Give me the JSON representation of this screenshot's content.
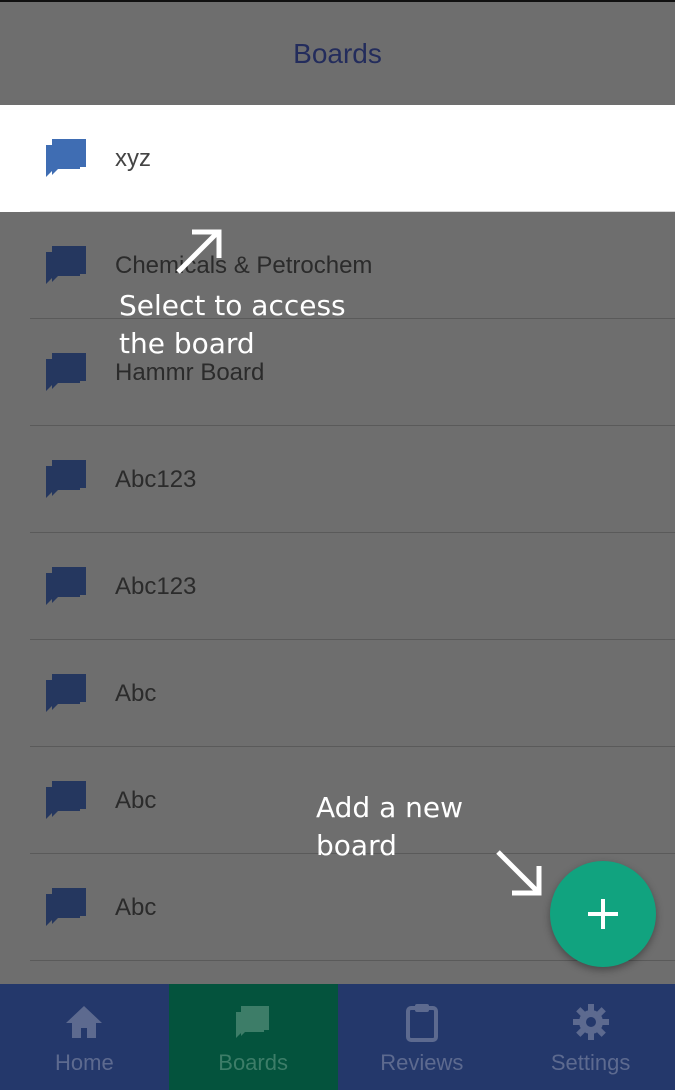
{
  "header": {
    "title": "Boards"
  },
  "boards": [
    {
      "name": "xyz",
      "highlighted": true
    },
    {
      "name": "Chemicals & Petrochem",
      "highlighted": false
    },
    {
      "name": "Hammr Board",
      "highlighted": false
    },
    {
      "name": "Abc123",
      "highlighted": false
    },
    {
      "name": "Abc123",
      "highlighted": false
    },
    {
      "name": "Abc",
      "highlighted": false
    },
    {
      "name": "Abc",
      "highlighted": false
    },
    {
      "name": "Abc",
      "highlighted": false
    }
  ],
  "annotations": {
    "select_line1": "Select to access",
    "select_line2": "the board",
    "add_line1": "Add a new",
    "add_line2": "board"
  },
  "fab": {
    "icon": "plus-icon",
    "color": "#11a37f"
  },
  "tabs": [
    {
      "label": "Home",
      "icon": "home-icon",
      "active": false
    },
    {
      "label": "Boards",
      "icon": "chat-bubbles-icon",
      "active": true
    },
    {
      "label": "Reviews",
      "icon": "clipboard-icon",
      "active": false
    },
    {
      "label": "Settings",
      "icon": "gear-icon",
      "active": false
    }
  ],
  "colors": {
    "tabbar": "#24386b",
    "active_tab": "#04533d",
    "board_icon": "#25375f",
    "board_icon_highlight": "#3f6db3",
    "header_title": "#232c5c"
  }
}
